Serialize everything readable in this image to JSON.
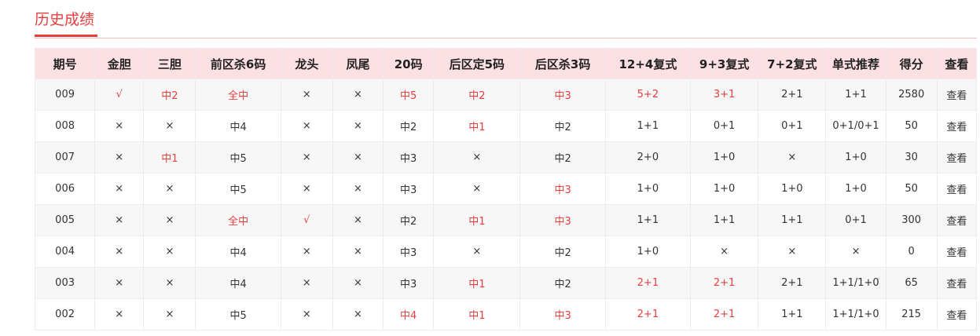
{
  "page": {
    "title": "历史成绩"
  },
  "colors": {
    "accent": "#e83e3e",
    "header_bg": "#fde0e4"
  },
  "table": {
    "headers": [
      "期号",
      "金胆",
      "三胆",
      "前区杀6码",
      "龙头",
      "凤尾",
      "20码",
      "后区定5码",
      "后区杀3码",
      "12+4复式",
      "9+3复式",
      "7+2复式",
      "单式推荐",
      "得分",
      "查看"
    ],
    "rows": [
      {
        "cells": [
          "009",
          "√",
          "中2",
          "全中",
          "×",
          "×",
          "中5",
          "中2",
          "中3",
          "5+2",
          "3+1",
          "2+1",
          "1+1",
          "2580",
          "查看"
        ],
        "hit": [
          false,
          true,
          true,
          true,
          false,
          false,
          true,
          true,
          true,
          true,
          true,
          false,
          false,
          false,
          false
        ]
      },
      {
        "cells": [
          "008",
          "×",
          "×",
          "中4",
          "×",
          "×",
          "中2",
          "中1",
          "中2",
          "1+1",
          "0+1",
          "0+1",
          "0+1/0+1",
          "50",
          "查看"
        ],
        "hit": [
          false,
          false,
          false,
          false,
          false,
          false,
          false,
          true,
          false,
          false,
          false,
          false,
          false,
          false,
          false
        ]
      },
      {
        "cells": [
          "007",
          "×",
          "中1",
          "中5",
          "×",
          "×",
          "中3",
          "×",
          "中2",
          "2+0",
          "1+0",
          "×",
          "1+0",
          "30",
          "查看"
        ],
        "hit": [
          false,
          false,
          true,
          false,
          false,
          false,
          false,
          false,
          false,
          false,
          false,
          false,
          false,
          false,
          false
        ]
      },
      {
        "cells": [
          "006",
          "×",
          "×",
          "中5",
          "×",
          "×",
          "中3",
          "×",
          "中3",
          "1+0",
          "1+0",
          "1+0",
          "1+0",
          "50",
          "查看"
        ],
        "hit": [
          false,
          false,
          false,
          false,
          false,
          false,
          false,
          false,
          true,
          false,
          false,
          false,
          false,
          false,
          false
        ]
      },
      {
        "cells": [
          "005",
          "×",
          "×",
          "全中",
          "√",
          "×",
          "中2",
          "中1",
          "中3",
          "1+1",
          "1+1",
          "1+1",
          "0+1",
          "300",
          "查看"
        ],
        "hit": [
          false,
          false,
          false,
          true,
          true,
          false,
          false,
          true,
          true,
          false,
          false,
          false,
          false,
          false,
          false
        ]
      },
      {
        "cells": [
          "004",
          "×",
          "×",
          "中4",
          "×",
          "×",
          "中3",
          "×",
          "中2",
          "1+0",
          "×",
          "×",
          "×",
          "0",
          "查看"
        ],
        "hit": [
          false,
          false,
          false,
          false,
          false,
          false,
          false,
          false,
          false,
          false,
          false,
          false,
          false,
          false,
          false
        ]
      },
      {
        "cells": [
          "003",
          "×",
          "×",
          "中4",
          "×",
          "×",
          "中3",
          "中1",
          "中2",
          "2+1",
          "2+1",
          "2+1",
          "1+1/1+0",
          "65",
          "查看"
        ],
        "hit": [
          false,
          false,
          false,
          false,
          false,
          false,
          false,
          true,
          false,
          true,
          true,
          false,
          false,
          false,
          false
        ]
      },
      {
        "cells": [
          "002",
          "×",
          "×",
          "中5",
          "×",
          "×",
          "中4",
          "中1",
          "中3",
          "2+1",
          "2+1",
          "1+1",
          "1+1/1+0",
          "215",
          "查看"
        ],
        "hit": [
          false,
          false,
          false,
          false,
          false,
          false,
          true,
          true,
          true,
          true,
          true,
          false,
          false,
          false,
          false
        ]
      }
    ]
  }
}
